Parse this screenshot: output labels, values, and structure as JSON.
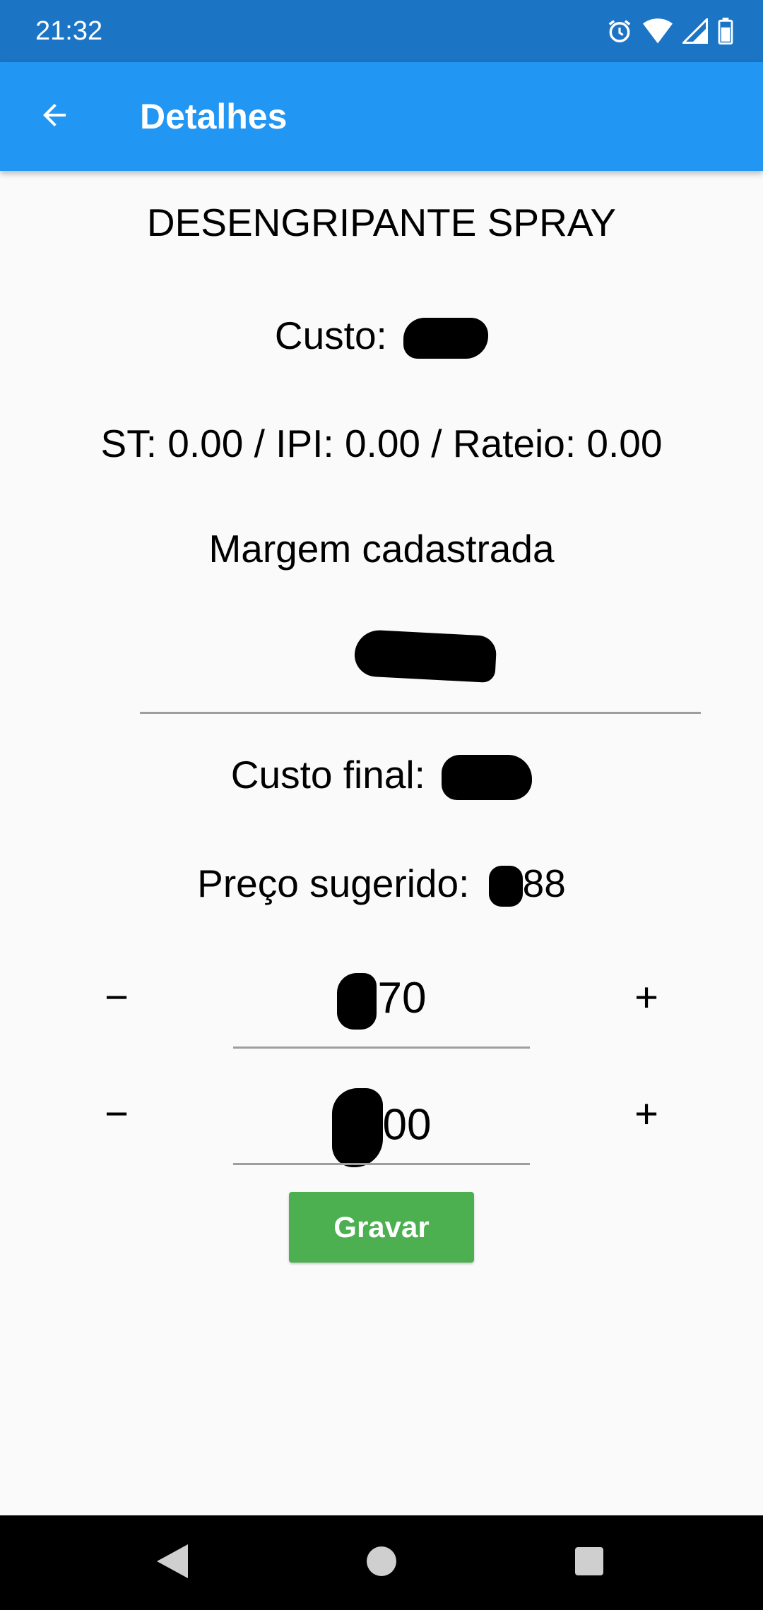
{
  "status_bar": {
    "time": "21:32",
    "icons": [
      "alarm-icon",
      "wifi-icon",
      "signal-icon",
      "battery-icon"
    ]
  },
  "app_bar": {
    "title": "Detalhes",
    "back_icon": "arrow-left-icon"
  },
  "product": {
    "name": "DESENGRIPANTE SPRAY",
    "cost_label": "Custo:",
    "taxes": "ST: 0.00 / IPI: 0.00 / Rateio: 0.00",
    "margin_label": "Margem cadastrada",
    "final_cost_label": "Custo final:",
    "suggested_price_label": "Preço sugerido:",
    "suggested_price_visible_digits": "88"
  },
  "steppers": [
    {
      "visible_value": "70",
      "minus": "−",
      "plus": "+"
    },
    {
      "visible_value": "00",
      "minus": "−",
      "plus": "+"
    }
  ],
  "actions": {
    "save_label": "Gravar"
  },
  "colors": {
    "status_bar": "#1c74c4",
    "app_bar": "#2196f3",
    "save_button": "#4caf50",
    "background": "#fafafa"
  }
}
